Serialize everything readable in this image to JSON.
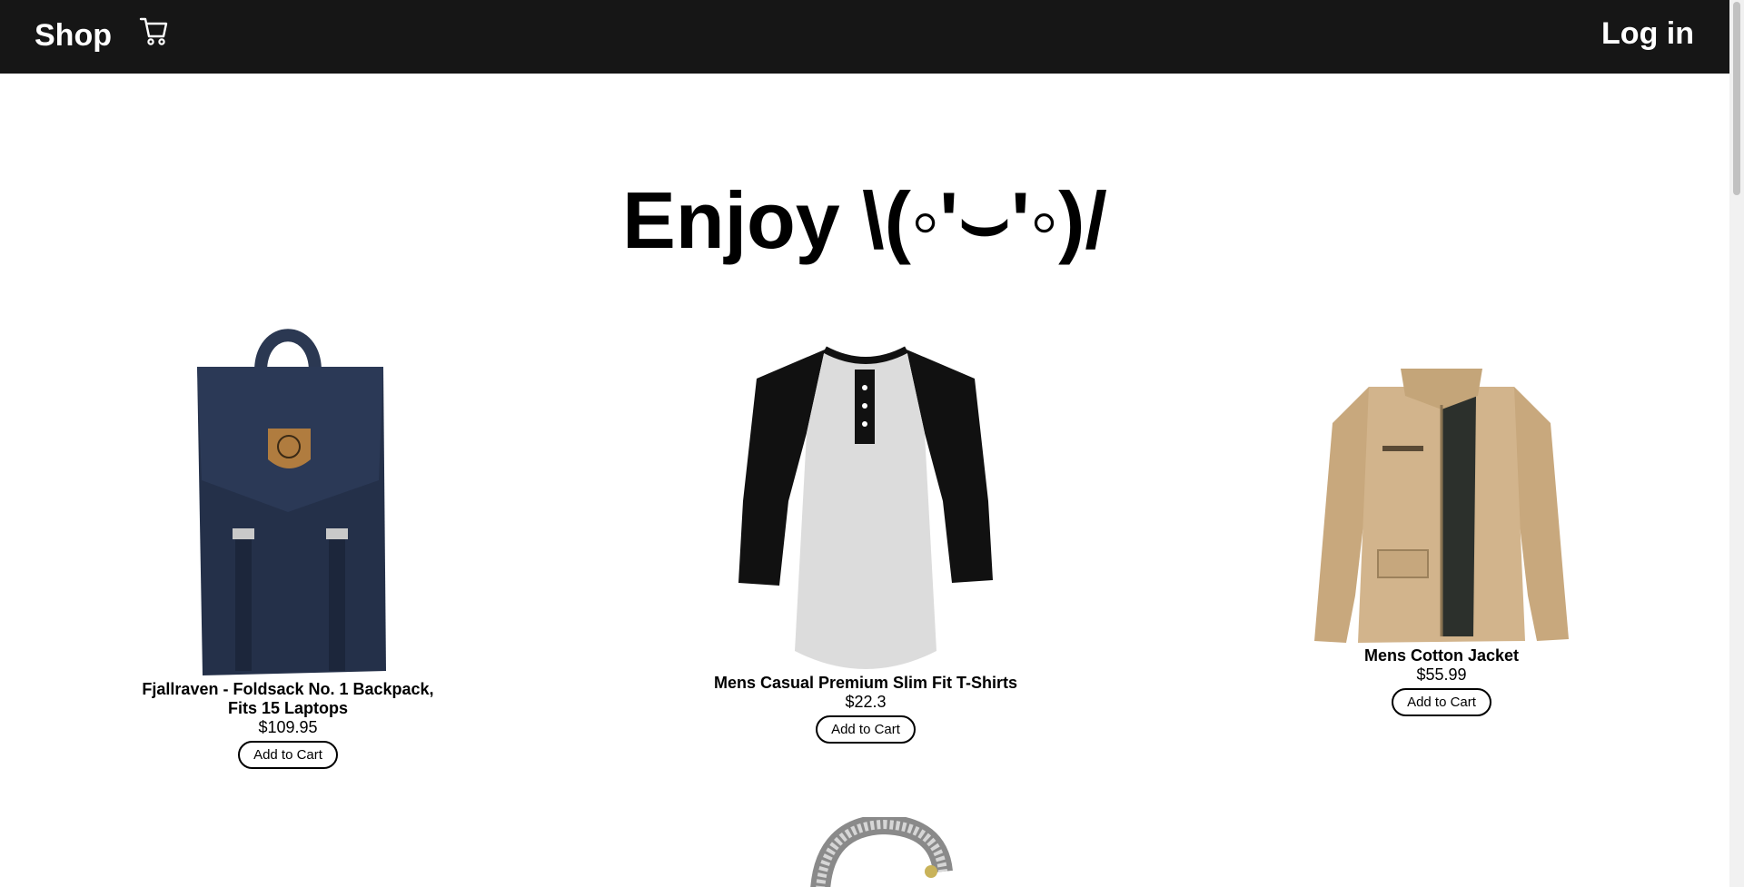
{
  "nav": {
    "brand": "Shop",
    "cart_icon": "shopping-cart-icon",
    "login": "Log in"
  },
  "hero": {
    "title": "Enjoy \\(◦'⌣'◦)/"
  },
  "products": [
    {
      "name": "Fjallraven - Foldsack No. 1 Backpack, Fits 15 Laptops",
      "price": "$109.95",
      "button": "Add to Cart",
      "image": "backpack"
    },
    {
      "name": "Mens Casual Premium Slim Fit T-Shirts",
      "price": "$22.3",
      "button": "Add to Cart",
      "image": "raglan-t-shirt"
    },
    {
      "name": "Mens Cotton Jacket",
      "price": "$55.99",
      "button": "Add to Cart",
      "image": "cotton-jacket"
    },
    {
      "name": "",
      "price": "",
      "button": "",
      "image": "silver-bracelet"
    }
  ],
  "colors": {
    "navbar_bg": "#161616",
    "backpack": "#243049",
    "jacket": "#d2b48c"
  }
}
